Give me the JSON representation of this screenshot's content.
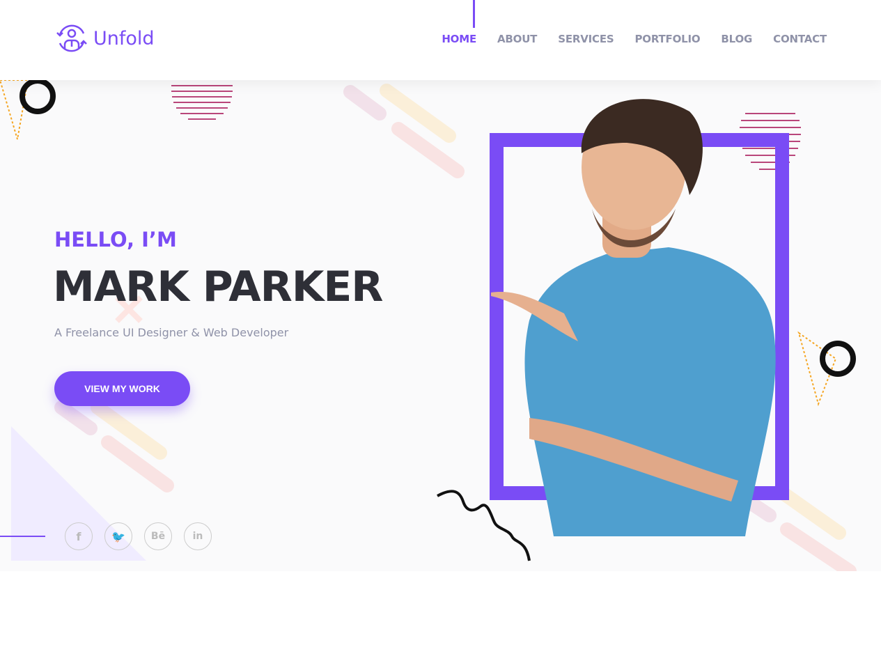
{
  "brand": {
    "name": "Unfold",
    "accent": "#7a4cf5"
  },
  "nav": {
    "items": [
      {
        "label": "HOME",
        "active": true
      },
      {
        "label": "ABOUT"
      },
      {
        "label": "SERVICES"
      },
      {
        "label": "PORTFOLIO"
      },
      {
        "label": "BLOG"
      },
      {
        "label": "CONTACT"
      }
    ]
  },
  "hero": {
    "greeting": "HELLO, I’M",
    "name": "MARK PARKER",
    "subtitle": "A Freelance UI Designer & Web Developer",
    "cta": "VIEW MY WORK"
  },
  "social": [
    {
      "icon": "facebook-icon",
      "glyph": "f"
    },
    {
      "icon": "twitter-icon",
      "glyph": "🐦"
    },
    {
      "icon": "behance-icon",
      "glyph": "Bē"
    },
    {
      "icon": "linkedin-icon",
      "glyph": "in"
    }
  ]
}
